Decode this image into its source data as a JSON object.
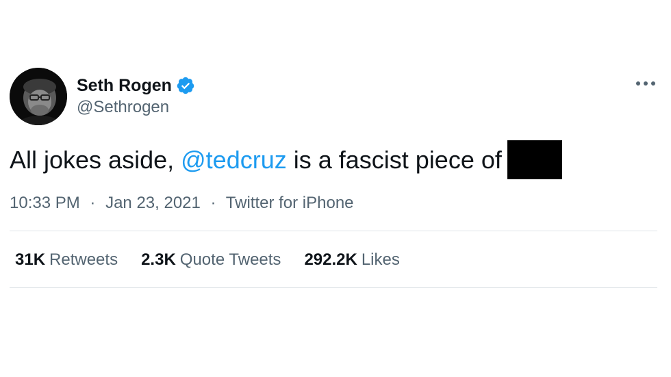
{
  "author": {
    "display_name": "Seth Rogen",
    "handle": "@Sethrogen",
    "verified": true
  },
  "tweet": {
    "text_before_mention": "All jokes aside, ",
    "mention": "@tedcruz",
    "text_after_mention": " is a fascist piece of",
    "redacted": true
  },
  "meta": {
    "time": "10:33 PM",
    "date": "Jan 23, 2021",
    "source": "Twitter for iPhone",
    "separator": "·"
  },
  "stats": {
    "retweets_count": "31K",
    "retweets_label": "Retweets",
    "quotes_count": "2.3K",
    "quotes_label": "Quote Tweets",
    "likes_count": "292.2K",
    "likes_label": "Likes"
  },
  "icons": {
    "verified": "verified-badge-icon",
    "more": "more-options-icon"
  },
  "colors": {
    "mention": "#1d9bf0",
    "verified": "#1d9bf0",
    "secondary_text": "#536471",
    "primary_text": "#0f1419",
    "divider": "#dfe4e8"
  }
}
